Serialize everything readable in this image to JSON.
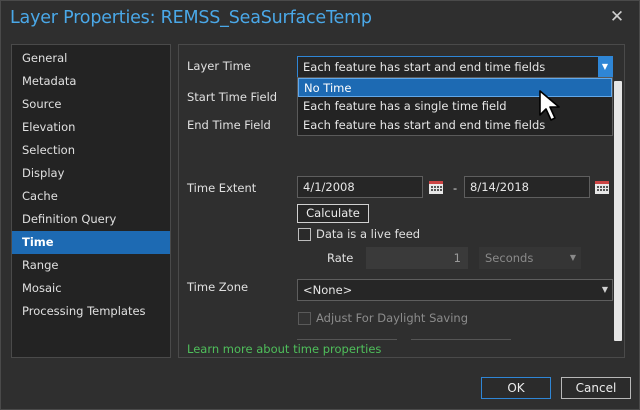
{
  "window": {
    "title": "Layer Properties: REMSS_SeaSurfaceTemp",
    "close_glyph": "✕"
  },
  "nav": {
    "items": [
      {
        "label": "General"
      },
      {
        "label": "Metadata"
      },
      {
        "label": "Source"
      },
      {
        "label": "Elevation"
      },
      {
        "label": "Selection"
      },
      {
        "label": "Display"
      },
      {
        "label": "Cache"
      },
      {
        "label": "Definition Query"
      },
      {
        "label": "Time"
      },
      {
        "label": "Range"
      },
      {
        "label": "Mosaic"
      },
      {
        "label": "Processing Templates"
      }
    ],
    "selected": "Time"
  },
  "time_panel": {
    "layer_time_label": "Layer Time",
    "layer_time_value": "Each feature has start and end time fields",
    "layer_time_options": [
      "No Time",
      "Each feature has a single time field",
      "Each feature has start and end time fields"
    ],
    "highlighted_option": "No Time",
    "start_time_field_label": "Start Time Field",
    "end_time_field_label": "End Time Field",
    "time_extent_label": "Time Extent",
    "time_extent_start": "4/1/2008",
    "time_extent_separator": "-",
    "time_extent_end": "8/14/2018",
    "calculate_label": "Calculate",
    "live_feed_label": "Data is a live feed",
    "live_feed_checked": false,
    "rate_label": "Rate",
    "rate_value": "1",
    "rate_unit": "Seconds",
    "time_zone_label": "Time Zone",
    "time_zone_value": "<None>",
    "daylight_saving_label": "Adjust For Daylight Saving",
    "daylight_saving_checked": false,
    "learn_more_link": "Learn more about time properties"
  },
  "footer": {
    "ok_label": "OK",
    "cancel_label": "Cancel"
  },
  "colors": {
    "accent": "#2f86d6",
    "title": "#4aa8e8",
    "selected_nav": "#1d6ab3",
    "link": "#4fbf5b"
  }
}
